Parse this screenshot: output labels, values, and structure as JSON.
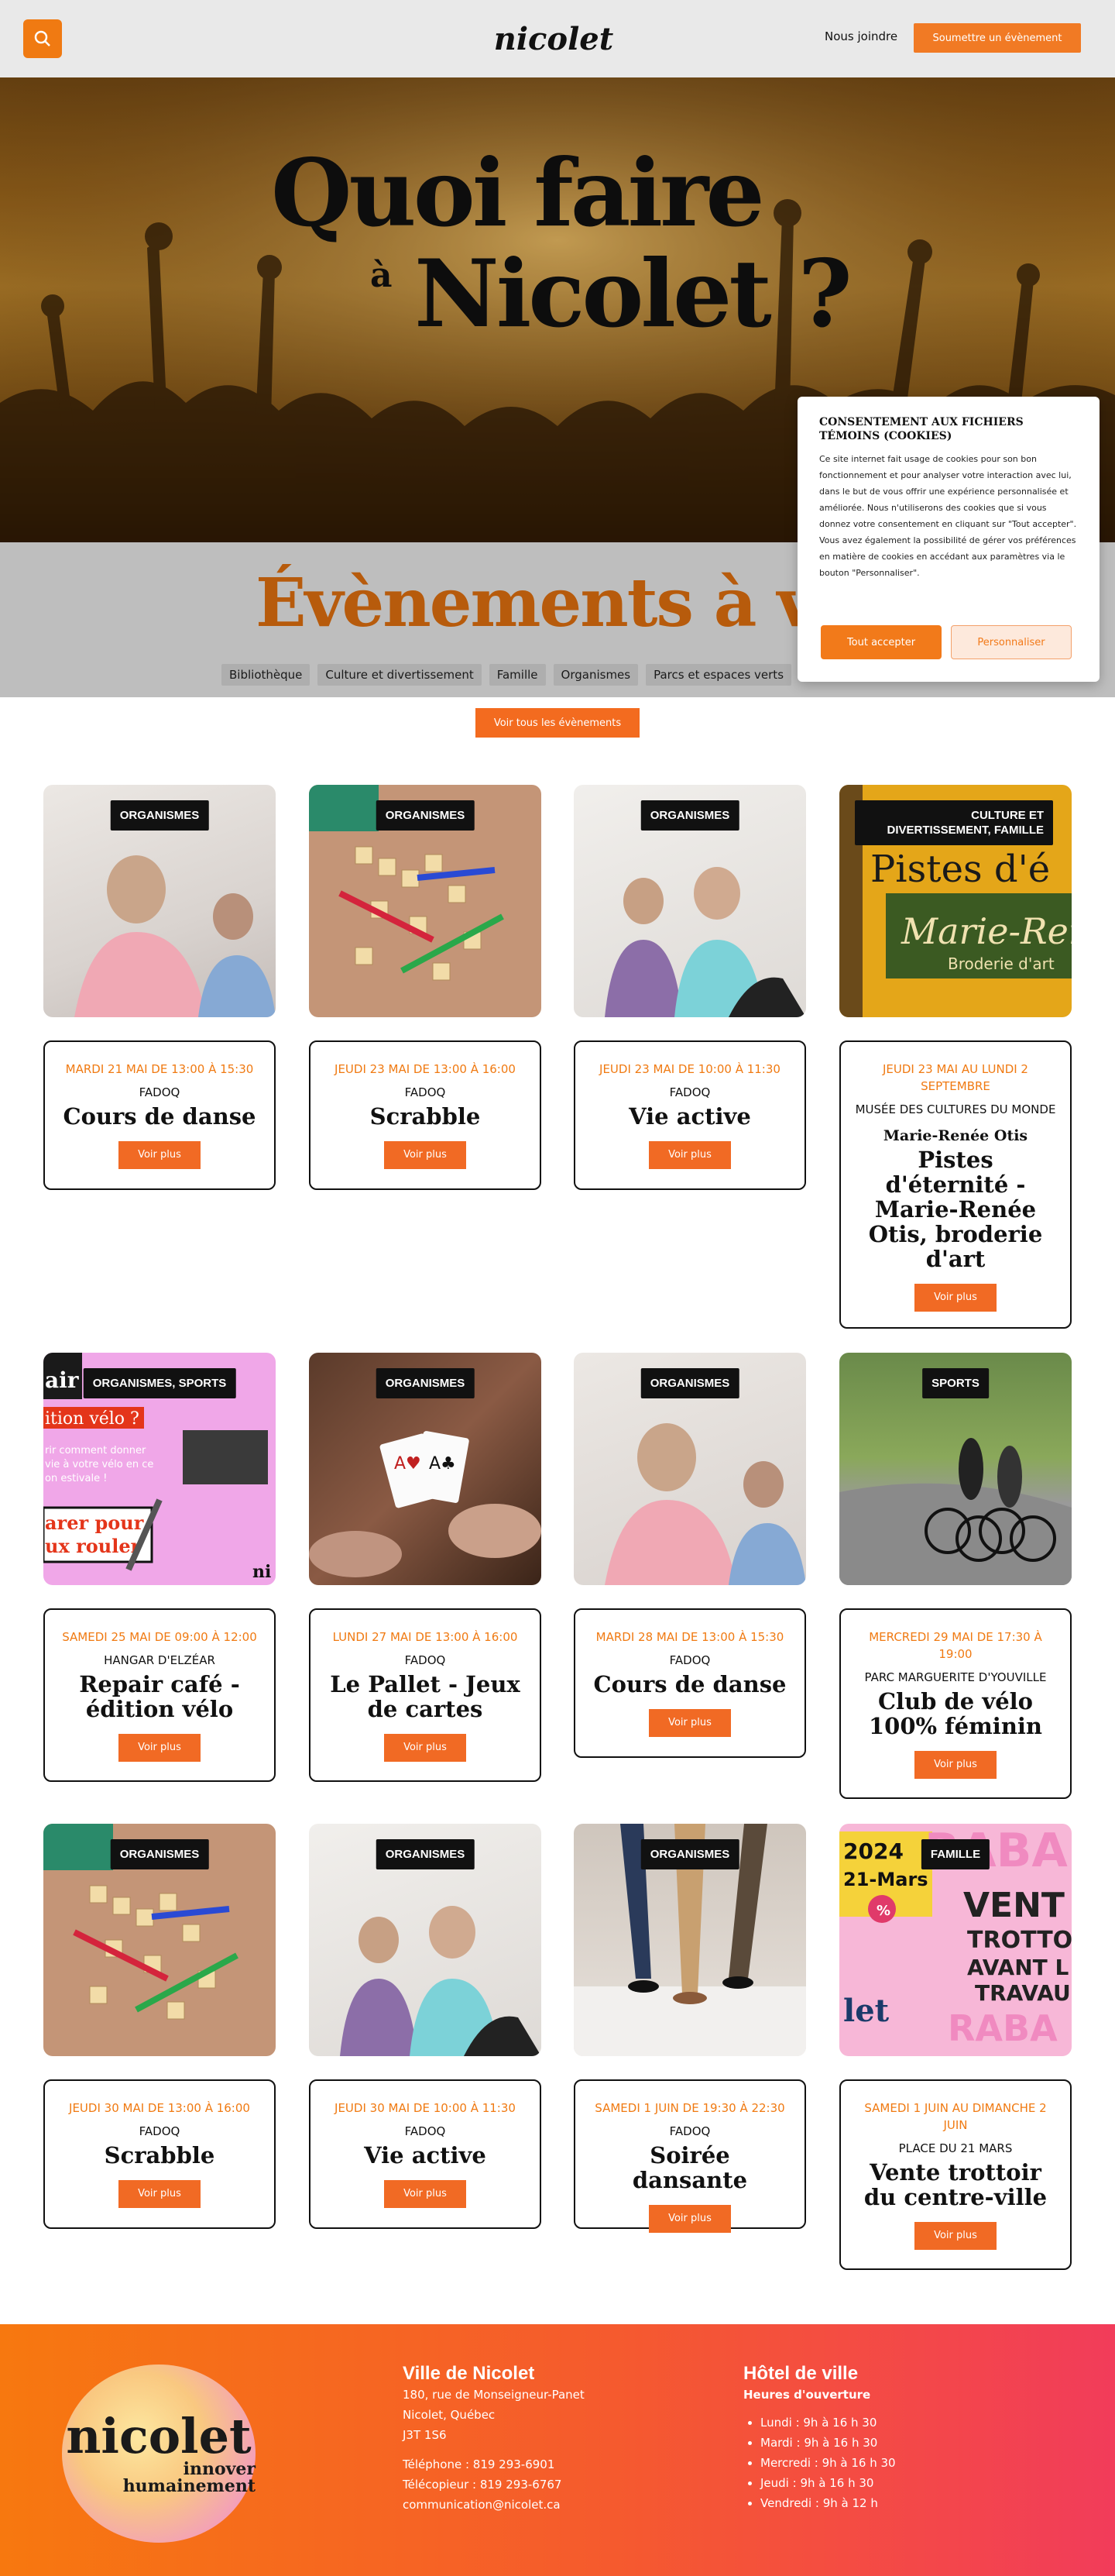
{
  "header": {
    "logo": "nicolet",
    "join": "Nous joindre",
    "submit": "Soumettre un évènement"
  },
  "hero": {
    "title_line1": "Quoi faire",
    "title_a": "à",
    "title_line2": "Nicolet ?"
  },
  "events_section": {
    "title": "Évènements à venir",
    "filters": [
      "Bibliothèque",
      "Culture et divertissement",
      "Famille",
      "Organismes",
      "Parcs et espaces verts"
    ],
    "view_all": "Voir tous les évènements",
    "more_label": "Voir plus"
  },
  "cookie": {
    "title": "CONSENTEMENT AUX FICHIERS TÉMOINS (COOKIES)",
    "text": "Ce site internet fait usage de cookies pour son bon fonctionnement et pour analyser votre interaction avec lui, dans le but de vous offrir une expérience personnalisée et améliorée. Nous n'utiliserons des cookies que si vous donnez votre consentement en cliquant sur \"Tout accepter\". Vous avez également la possibilité de gérer vos préférences en matière de cookies en accédant aux paramètres via le bouton \"Personnaliser\".",
    "accept": "Tout accepter",
    "customize": "Personnaliser"
  },
  "events": [
    {
      "tag": "ORGANISMES",
      "date": "MARDI 21 MAI DE 13:00 À 15:30",
      "org": "FADOQ",
      "title": "Cours de danse"
    },
    {
      "tag": "ORGANISMES",
      "date": "JEUDI 23 MAI DE 13:00 À 16:00",
      "org": "FADOQ",
      "title": "Scrabble"
    },
    {
      "tag": "ORGANISMES",
      "date": "JEUDI 23 MAI DE 10:00 À 11:30",
      "org": "FADOQ",
      "title": "Vie active"
    },
    {
      "tag": "CULTURE ET DIVERTISSEMENT, FAMILLE",
      "date": "JEUDI 23 MAI AU LUNDI 2 SEPTEMBRE",
      "org": "MUSÉE DES CULTURES DU MONDE",
      "subtitle": "Marie-Renée Otis",
      "title": "Pistes d'éternité - Marie-Renée Otis, broderie d'art",
      "img_text": "Pistes d'é… Marie-Ren… Broderie d'art"
    },
    {
      "tag": "ORGANISMES, SPORTS",
      "date": "SAMEDI 25 MAI DE 09:00 À 12:00",
      "org": "HANGAR D'ELZÉAR",
      "title": "Repair café - édition vélo",
      "img_text": "air… ition vélo ? …rir comment donner …vie à votre vélo en ce …on estivale ! …arer pour …ux rouler"
    },
    {
      "tag": "ORGANISMES",
      "date": "LUNDI 27 MAI DE 13:00 À 16:00",
      "org": "FADOQ",
      "title": "Le Pallet - Jeux de cartes"
    },
    {
      "tag": "ORGANISMES",
      "date": "MARDI 28 MAI DE 13:00 À 15:30",
      "org": "FADOQ",
      "title": "Cours de danse"
    },
    {
      "tag": "SPORTS",
      "date": "MERCREDI 29 MAI DE 17:30 À 19:00",
      "org": "PARC MARGUERITE D'YOUVILLE",
      "title": "Club de vélo 100% féminin"
    },
    {
      "tag": "ORGANISMES",
      "date": "JEUDI 30 MAI DE 13:00 À 16:00",
      "org": "FADOQ",
      "title": "Scrabble"
    },
    {
      "tag": "ORGANISMES",
      "date": "JEUDI 30 MAI DE 10:00 À 11:30",
      "org": "FADOQ",
      "title": "Vie active"
    },
    {
      "tag": "ORGANISMES",
      "date": "SAMEDI 1 JUIN DE 19:30 À 22:30",
      "org": "FADOQ",
      "title": "Soirée dansante"
    },
    {
      "tag": "FAMILLE",
      "date": "SAMEDI 1 JUIN AU DIMANCHE 2 JUIN",
      "org": "PLACE DU 21 MARS",
      "title": "Vente trottoir du centre-ville",
      "img_text": "2024 21-Mars VENT… TROTTO… AVANT L… TRAVAU… RABA…"
    }
  ],
  "footer": {
    "logo_main": "nicolet",
    "logo_sub": "innover humainement",
    "city": {
      "title": "Ville de Nicolet",
      "address1": "180, rue de Monseigneur-Panet",
      "address2": "Nicolet, Québec",
      "postal": "J3T 1S6",
      "phone": "Téléphone : 819 293-6901",
      "fax": "Télécopieur : 819 293-6767",
      "email": "communication@nicolet.ca"
    },
    "hall": {
      "title": "Hôtel de ville",
      "hours_title": "Heures d'ouverture",
      "hours": [
        "Lundi : 9h à 16 h 30",
        "Mardi : 9h à 16 h 30",
        "Mercredi : 9h à 16 h 30",
        "Jeudi : 9h à 16 h 30",
        "Vendredi : 9h à 12 h"
      ]
    }
  }
}
